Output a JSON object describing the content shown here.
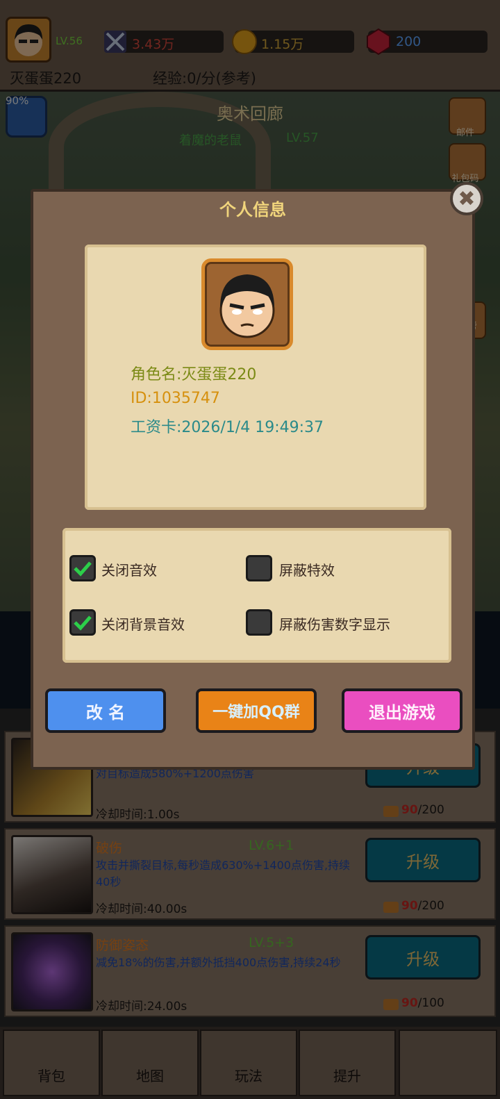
{
  "header": {
    "level": "LV.56",
    "combat_power": "3.43万",
    "gold": "1.15万",
    "gems": "200",
    "player_name": "灭蛋蛋220",
    "exp_rate": "经验:0/分(参考)"
  },
  "scene": {
    "exp_percent": "90%",
    "map_title": "奥术回廊",
    "enemy_name": "着魔的老鼠",
    "enemy_level": "LV.57",
    "side_buttons": [
      "邮件",
      "礼包码",
      "榜"
    ]
  },
  "modal": {
    "title": "个人信息",
    "close_symbol": "✖",
    "character_name": "角色名:灭蛋蛋220",
    "character_id": "ID:1035747",
    "wage_card": "工资卡:2026/1/4 19:49:37",
    "settings": [
      {
        "label": "关闭音效",
        "checked": true
      },
      {
        "label": "屏蔽特效",
        "checked": false
      },
      {
        "label": "关闭背景音效",
        "checked": true
      },
      {
        "label": "屏蔽伤害数字显示",
        "checked": false
      }
    ],
    "buttons": {
      "rename": "改 名",
      "join_qq": "一键加QQ群",
      "exit": "退出游戏"
    }
  },
  "skills": [
    {
      "name": "",
      "level": "",
      "desc": "对目标造成580%+1200点伤害",
      "cooldown": "冷却时间:1.00s",
      "button": "升级",
      "cost_have": "90",
      "cost_need": "/200"
    },
    {
      "name": "破伤",
      "level": "LV.6+1",
      "desc": "攻击并撕裂目标,每秒造成630%+1400点伤害,持续40秒",
      "cooldown": "冷却时间:40.00s",
      "button": "升级",
      "cost_have": "90",
      "cost_need": "/200"
    },
    {
      "name": "防御姿态",
      "level": "LV.5+3",
      "desc": "减免18%的伤害,并额外抵挡400点伤害,持续24秒",
      "cooldown": "冷却时间:24.00s",
      "button": "升级",
      "cost_have": "90",
      "cost_need": "/100"
    }
  ],
  "bottom_nav": [
    "背包",
    "地图",
    "玩法",
    "提升",
    ""
  ],
  "colors": {
    "modal_bg": "#7c6350",
    "parchment": "#e9d8b0",
    "rename_button": "#4e90ee",
    "qq_button": "#e98317",
    "exit_button": "#ea4ec0",
    "upgrade_button": "#0b6e84"
  }
}
